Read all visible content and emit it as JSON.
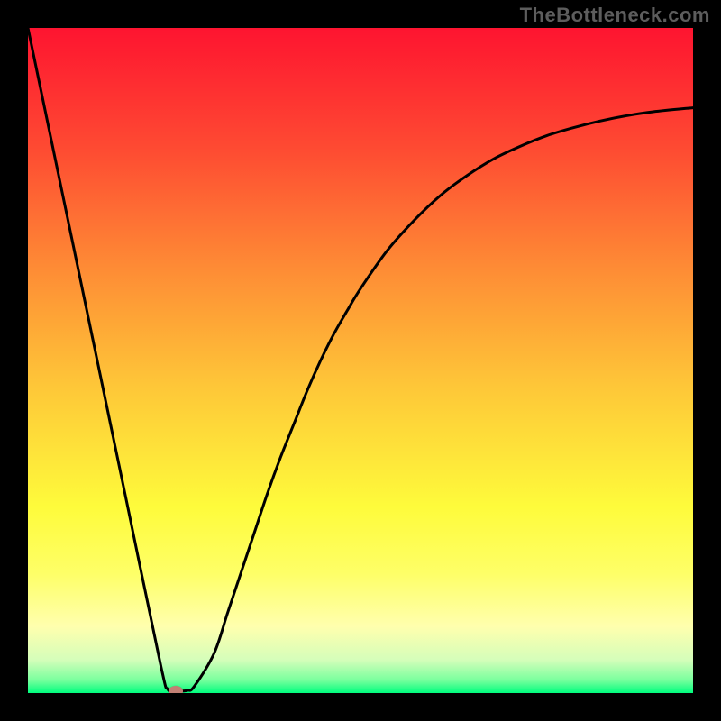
{
  "watermark": "TheBottleneck.com",
  "chart_data": {
    "type": "line",
    "title": "",
    "xlabel": "",
    "ylabel": "",
    "xlim": [
      0,
      100
    ],
    "ylim": [
      0,
      100
    ],
    "series": [
      {
        "name": "curve",
        "x": [
          0,
          5,
          10,
          15,
          20,
          21,
          22,
          23,
          24,
          25,
          28,
          30,
          32,
          34,
          36,
          38,
          40,
          42,
          44,
          46,
          48,
          50,
          54,
          58,
          62,
          66,
          70,
          74,
          78,
          82,
          86,
          90,
          94,
          100
        ],
        "y": [
          100,
          76,
          52,
          28,
          4,
          0.6,
          0.3,
          0.3,
          0.4,
          1,
          6,
          12,
          18,
          24,
          30,
          35.5,
          40.5,
          45.5,
          50,
          54,
          57.5,
          60.8,
          66.5,
          71,
          74.8,
          77.8,
          80.3,
          82.2,
          83.8,
          85,
          86,
          86.8,
          87.4,
          88
        ]
      }
    ],
    "annotations": [
      {
        "name": "min-marker",
        "x": 22.2,
        "y": 0.3,
        "color": "#c28074"
      }
    ],
    "background_gradient": {
      "stops": [
        {
          "offset": 0.0,
          "color": "#fe1430"
        },
        {
          "offset": 0.18,
          "color": "#fe4a32"
        },
        {
          "offset": 0.36,
          "color": "#fe8b35"
        },
        {
          "offset": 0.54,
          "color": "#fec738"
        },
        {
          "offset": 0.72,
          "color": "#fefb3b"
        },
        {
          "offset": 0.82,
          "color": "#feff67"
        },
        {
          "offset": 0.9,
          "color": "#ffffae"
        },
        {
          "offset": 0.95,
          "color": "#d5feba"
        },
        {
          "offset": 0.98,
          "color": "#7bff9e"
        },
        {
          "offset": 1.0,
          "color": "#00fe7e"
        }
      ]
    }
  }
}
